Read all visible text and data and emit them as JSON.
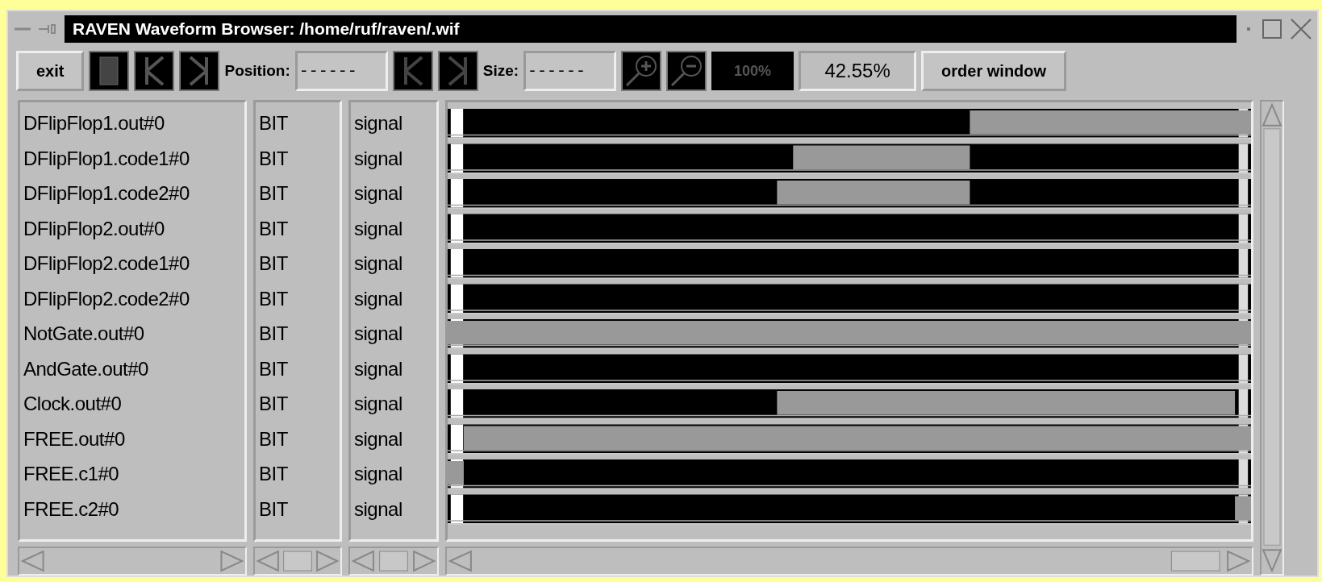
{
  "window": {
    "title": "RAVEN Waveform Browser: /home/ruf/raven/.wif"
  },
  "toolbar": {
    "exit": "exit",
    "position_label": "Position:",
    "position_value": "------",
    "size_label": "Size:",
    "size_value": "------",
    "zoom_reset": "100%",
    "zoom_value": "42.55%",
    "order": "order window"
  },
  "signals": [
    {
      "name": "DFlipFlop1.out#0",
      "type": "BIT",
      "kind": "signal"
    },
    {
      "name": "DFlipFlop1.code1#0",
      "type": "BIT",
      "kind": "signal"
    },
    {
      "name": "DFlipFlop1.code2#0",
      "type": "BIT",
      "kind": "signal"
    },
    {
      "name": "DFlipFlop2.out#0",
      "type": "BIT",
      "kind": "signal"
    },
    {
      "name": "DFlipFlop2.code1#0",
      "type": "BIT",
      "kind": "signal"
    },
    {
      "name": "DFlipFlop2.code2#0",
      "type": "BIT",
      "kind": "signal"
    },
    {
      "name": "NotGate.out#0",
      "type": "BIT",
      "kind": "signal"
    },
    {
      "name": "AndGate.out#0",
      "type": "BIT",
      "kind": "signal"
    },
    {
      "name": "Clock.out#0",
      "type": "BIT",
      "kind": "signal"
    },
    {
      "name": "FREE.out#0",
      "type": "BIT",
      "kind": "signal"
    },
    {
      "name": "FREE.c1#0",
      "type": "BIT",
      "kind": "signal"
    },
    {
      "name": "FREE.c2#0",
      "type": "BIT",
      "kind": "signal"
    }
  ]
}
